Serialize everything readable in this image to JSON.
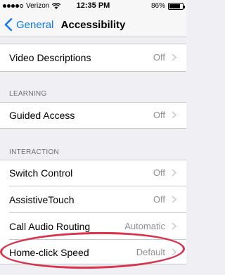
{
  "status_bar": {
    "carrier": "Verizon",
    "time": "12:35 PM",
    "battery_percent": "86%",
    "battery_level": 0.86,
    "signal_bars": 4,
    "signal_total": 5
  },
  "nav": {
    "back_label": "General",
    "title": "Accessibility"
  },
  "rows": {
    "video_descriptions": {
      "label": "Video Descriptions",
      "value": "Off"
    },
    "guided_access": {
      "label": "Guided Access",
      "value": "Off"
    },
    "switch_control": {
      "label": "Switch Control",
      "value": "Off"
    },
    "assistive_touch": {
      "label": "AssistiveTouch",
      "value": "Off"
    },
    "call_audio_routing": {
      "label": "Call Audio Routing",
      "value": "Automatic"
    },
    "home_click_speed": {
      "label": "Home-click Speed",
      "value": "Default"
    }
  },
  "sections": {
    "learning": "LEARNING",
    "interaction": "INTERACTION"
  },
  "colors": {
    "accent": "#0a7aff",
    "annotation": "#d8344c",
    "background": "#efeff4"
  }
}
